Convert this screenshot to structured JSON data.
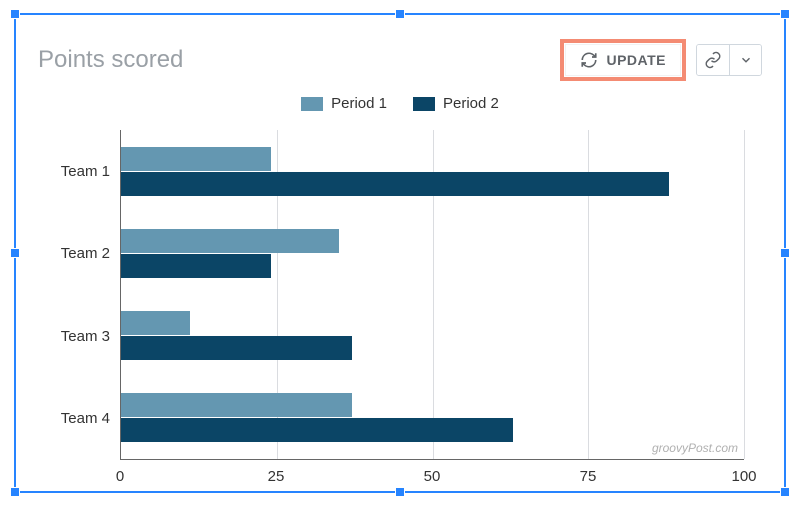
{
  "title": "Points scored",
  "toolbar": {
    "update_label": "UPDATE"
  },
  "watermark": "groovyPost.com",
  "legend": [
    {
      "label": "Period 1",
      "color": "#6497b1"
    },
    {
      "label": "Period 2",
      "color": "#0b4566"
    }
  ],
  "xticks": [
    "0",
    "25",
    "50",
    "75",
    "100"
  ],
  "chart_data": {
    "type": "bar",
    "orientation": "horizontal",
    "title": "Points scored",
    "xlabel": "",
    "ylabel": "",
    "xlim": [
      0,
      100
    ],
    "categories": [
      "Team 1",
      "Team 2",
      "Team 3",
      "Team 4"
    ],
    "series": [
      {
        "name": "Period 1",
        "values": [
          24,
          35,
          11,
          37
        ]
      },
      {
        "name": "Period 2",
        "values": [
          88,
          24,
          37,
          63
        ]
      }
    ]
  }
}
